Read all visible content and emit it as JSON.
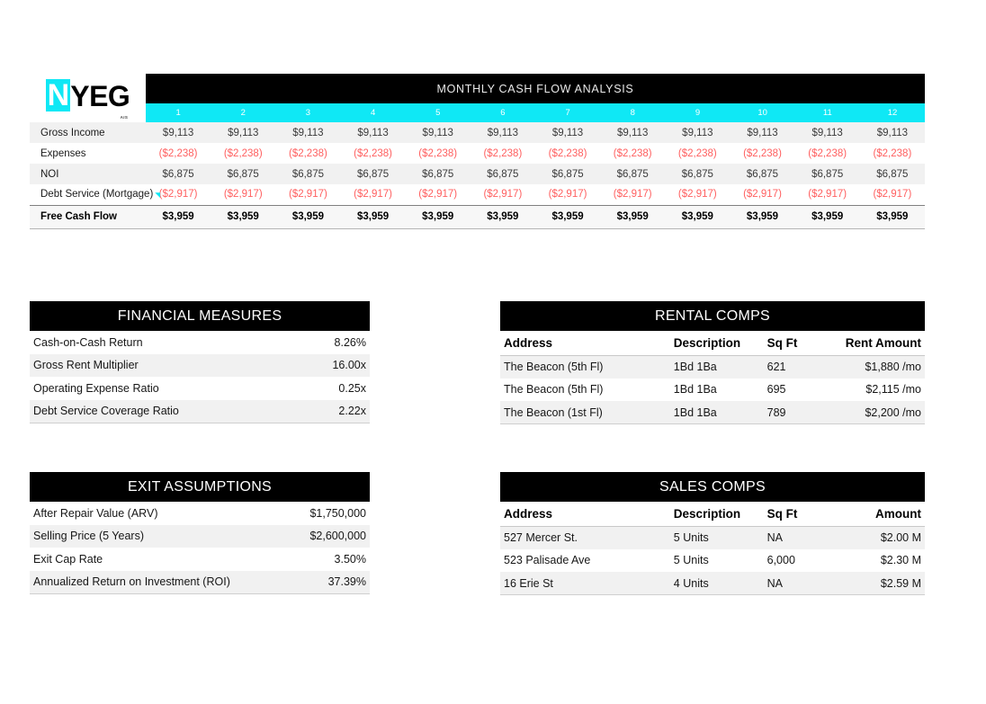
{
  "logo": {
    "mark": "N",
    "word": "YEG",
    "sub": "AIS"
  },
  "cash_flow": {
    "title": "MONTHLY CASH FLOW ANALYSIS",
    "months": [
      "1",
      "2",
      "3",
      "4",
      "5",
      "6",
      "7",
      "8",
      "9",
      "10",
      "11",
      "12"
    ],
    "rows": [
      {
        "label": "Gross Income",
        "values": [
          "$9,113",
          "$9,113",
          "$9,113",
          "$9,113",
          "$9,113",
          "$9,113",
          "$9,113",
          "$9,113",
          "$9,113",
          "$9,113",
          "$9,113",
          "$9,113"
        ],
        "negative": false,
        "flag": false
      },
      {
        "label": "Expenses",
        "values": [
          "($2,238)",
          "($2,238)",
          "($2,238)",
          "($2,238)",
          "($2,238)",
          "($2,238)",
          "($2,238)",
          "($2,238)",
          "($2,238)",
          "($2,238)",
          "($2,238)",
          "($2,238)"
        ],
        "negative": true,
        "flag": false
      },
      {
        "label": "NOI",
        "values": [
          "$6,875",
          "$6,875",
          "$6,875",
          "$6,875",
          "$6,875",
          "$6,875",
          "$6,875",
          "$6,875",
          "$6,875",
          "$6,875",
          "$6,875",
          "$6,875"
        ],
        "negative": false,
        "flag": false
      },
      {
        "label": "Debt Service (Mortgage)",
        "values": [
          "($2,917)",
          "($2,917)",
          "($2,917)",
          "($2,917)",
          "($2,917)",
          "($2,917)",
          "($2,917)",
          "($2,917)",
          "($2,917)",
          "($2,917)",
          "($2,917)",
          "($2,917)"
        ],
        "negative": true,
        "flag": true
      },
      {
        "label": "Free Cash Flow",
        "values": [
          "$3,959",
          "$3,959",
          "$3,959",
          "$3,959",
          "$3,959",
          "$3,959",
          "$3,959",
          "$3,959",
          "$3,959",
          "$3,959",
          "$3,959",
          "$3,959"
        ],
        "negative": false,
        "flag": false,
        "total": true
      }
    ]
  },
  "financial_measures": {
    "title": "FINANCIAL MEASURES",
    "rows": [
      {
        "label": "Cash-on-Cash Return",
        "value": "8.26%"
      },
      {
        "label": "Gross Rent Multiplier",
        "value": "16.00x"
      },
      {
        "label": "Operating Expense Ratio",
        "value": "0.25x"
      },
      {
        "label": "Debt Service Coverage Ratio",
        "value": "2.22x"
      }
    ]
  },
  "exit_assumptions": {
    "title": "EXIT ASSUMPTIONS",
    "rows": [
      {
        "label": "After Repair Value (ARV)",
        "value": "$1,750,000"
      },
      {
        "label": "Selling Price  (5 Years)",
        "value": "$2,600,000"
      },
      {
        "label": "Exit Cap Rate",
        "value": "3.50%"
      },
      {
        "label": "Annualized Return on Investment (ROI)",
        "value": "37.39%"
      }
    ]
  },
  "rental_comps": {
    "title": "RENTAL COMPS",
    "columns": [
      "Address",
      "Description",
      "Sq Ft",
      "Rent Amount"
    ],
    "rows": [
      [
        "The Beacon (5th Fl)",
        "1Bd 1Ba",
        "621",
        "$1,880 /mo"
      ],
      [
        "The Beacon (5th Fl)",
        "1Bd 1Ba",
        "695",
        "$2,115 /mo"
      ],
      [
        "The Beacon (1st Fl)",
        "1Bd 1Ba",
        "789",
        "$2,200 /mo"
      ]
    ]
  },
  "sales_comps": {
    "title": "SALES COMPS",
    "columns": [
      "Address",
      "Description",
      "Sq Ft",
      "Amount"
    ],
    "rows": [
      [
        "527 Mercer St.",
        "5 Units",
        "NA",
        "$2.00 M"
      ],
      [
        "523 Palisade Ave",
        "5 Units",
        "6,000",
        "$2.30 M"
      ],
      [
        "16 Erie St",
        "4 Units",
        "NA",
        "$2.59 M"
      ]
    ]
  },
  "colors": {
    "accent": "#0FE8F5",
    "header": "#000000",
    "negative": "#FF5F5F",
    "stripe": "#f1f1f1"
  }
}
